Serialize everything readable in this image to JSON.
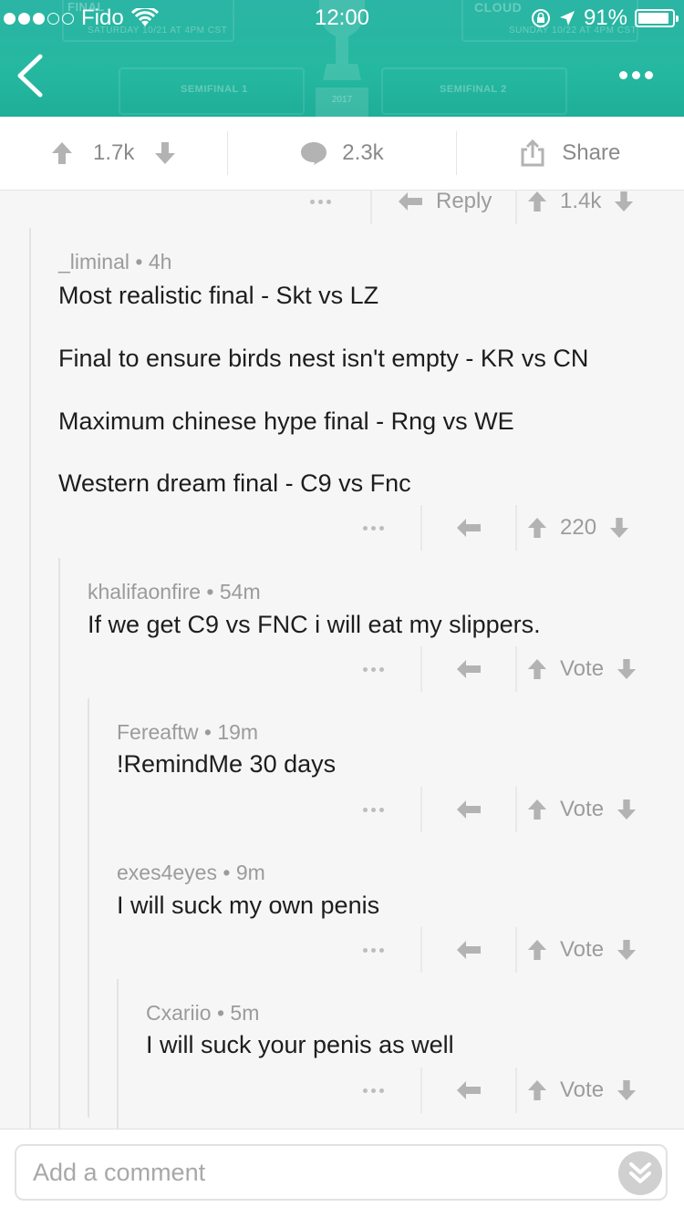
{
  "status_bar": {
    "carrier": "Fido",
    "time": "12:00",
    "battery": "91%",
    "battery_level": 0.91
  },
  "header_banner": {
    "label_left": "SEMIFINAL 1",
    "label_right": "SEMIFINAL 2",
    "faded_top_left": "SATURDAY 10/21 AT 4PM CST",
    "faded_top_right": "SUNDAY 10/22 AT 4PM CST",
    "faded_final": "FINAL",
    "faded_cloud": "CLOUD",
    "faded_year": "2017"
  },
  "post_bar": {
    "upvotes": "1.7k",
    "comments": "2.3k",
    "share": "Share"
  },
  "top_reply_bar": {
    "reply_label": "Reply",
    "score": "1.4k"
  },
  "comments": [
    {
      "author": "_liminal",
      "age": "4h",
      "lines": [
        "Most realistic final - Skt vs LZ",
        "Final to ensure birds nest isn't empty -  KR vs CN",
        "Maximum chinese hype final - Rng vs WE",
        "Western dream final - C9 vs Fnc"
      ],
      "score": "220"
    },
    {
      "author": "khalifaonfire",
      "age": "54m",
      "lines": [
        "If we get C9 vs FNC i will eat my slippers."
      ],
      "score": "Vote"
    },
    {
      "author": "Fereaftw",
      "age": "19m",
      "lines": [
        "!RemindMe 30 days"
      ],
      "score": "Vote"
    },
    {
      "author": "exes4eyes",
      "age": "9m",
      "lines": [
        "I will suck my own penis"
      ],
      "score": "Vote"
    },
    {
      "author": "Cxariio",
      "age": "5m",
      "lines": [
        "I will suck your penis as well"
      ],
      "score": "Vote"
    }
  ],
  "footer": {
    "placeholder": "Add a comment"
  },
  "colors": {
    "header": "#25b8a0",
    "text": "#1d1d1d",
    "meta": "#9b9b9b",
    "icon": "#b3b3b3"
  },
  "icons": [
    "back-chevron-icon",
    "more-dots-icon",
    "upvote-arrow-icon",
    "downvote-arrow-icon",
    "comment-bubble-icon",
    "share-icon",
    "reply-arrow-icon",
    "collapse-chevrons-icon"
  ]
}
